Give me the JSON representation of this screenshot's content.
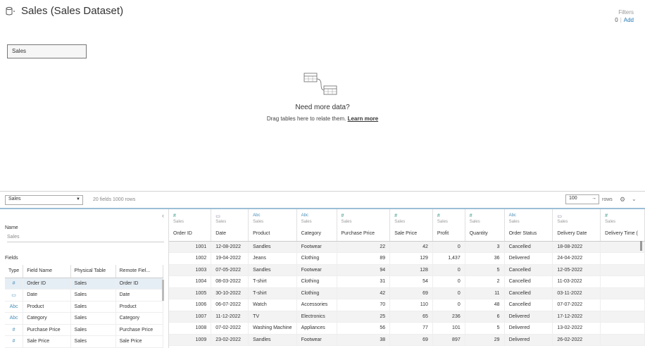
{
  "datasource": {
    "title": "Sales (Sales Dataset)",
    "icon": "datasource-icon"
  },
  "filters": {
    "label": "Filters",
    "count": "0",
    "sep": "|",
    "add": "Add"
  },
  "canvas": {
    "table_pill": "Sales",
    "need_more_title": "Need more data?",
    "need_more_sub": "Drag tables here to relate them.",
    "learn_more": "Learn more"
  },
  "toolbar": {
    "table_select": "Sales",
    "info": "20 fields 1000 rows",
    "rows_value": "100",
    "rows_arrow": "→",
    "rows_label": "rows",
    "gear_glyph": "⚙",
    "chevron_glyph": "⌄"
  },
  "meta": {
    "collapse_glyph": "‹",
    "name_label": "Name",
    "name_value": "Sales",
    "fields_label": "Fields",
    "columns": [
      "Type",
      "Field Name",
      "Physical Table",
      "Remote Fiel..."
    ],
    "rows": [
      {
        "type": "#",
        "field": "Order ID",
        "table": "Sales",
        "remote": "Order ID"
      },
      {
        "type": "▭",
        "field": "Date",
        "table": "Sales",
        "remote": "Date"
      },
      {
        "type": "Abc",
        "field": "Product",
        "table": "Sales",
        "remote": "Product"
      },
      {
        "type": "Abc",
        "field": "Category",
        "table": "Sales",
        "remote": "Category"
      },
      {
        "type": "#",
        "field": "Purchase Price",
        "table": "Sales",
        "remote": "Purchase Price"
      },
      {
        "type": "#",
        "field": "Sale Price",
        "table": "Sales",
        "remote": "Sale Price"
      }
    ]
  },
  "grid": {
    "columns": [
      {
        "type": "#",
        "kind": "num",
        "source": "Sales",
        "name": "Order ID"
      },
      {
        "type": "▭",
        "kind": "dt",
        "source": "Sales",
        "name": "Date"
      },
      {
        "type": "Abc",
        "kind": "txt",
        "source": "Sales",
        "name": "Product"
      },
      {
        "type": "Abc",
        "kind": "txt",
        "source": "Sales",
        "name": "Category"
      },
      {
        "type": "#",
        "kind": "num",
        "source": "Sales",
        "name": "Purchase Price"
      },
      {
        "type": "#",
        "kind": "num",
        "source": "Sales",
        "name": "Sale Price"
      },
      {
        "type": "#",
        "kind": "num",
        "source": "Sales",
        "name": "Profit"
      },
      {
        "type": "#",
        "kind": "num",
        "source": "Sales",
        "name": "Quantity"
      },
      {
        "type": "Abc",
        "kind": "txt",
        "source": "Sales",
        "name": "Order Status"
      },
      {
        "type": "▭",
        "kind": "dt",
        "source": "Sales",
        "name": "Delivery Date"
      },
      {
        "type": "#",
        "kind": "num",
        "source": "Sales",
        "name": "Delivery Time ("
      }
    ],
    "rows": [
      [
        "1001",
        "12-08-2022",
        "Sandles",
        "Footwear",
        "22",
        "42",
        "0",
        "3",
        "Cancelled",
        "18-08-2022",
        ""
      ],
      [
        "1002",
        "19-04-2022",
        "Jeans",
        "Clothing",
        "89",
        "129",
        "1,437",
        "36",
        "Delivered",
        "24-04-2022",
        ""
      ],
      [
        "1003",
        "07-05-2022",
        "Sandles",
        "Footwear",
        "94",
        "128",
        "0",
        "5",
        "Cancelled",
        "12-05-2022",
        ""
      ],
      [
        "1004",
        "08-03-2022",
        "T-shirt",
        "Clothing",
        "31",
        "54",
        "0",
        "2",
        "Cancelled",
        "11-03-2022",
        ""
      ],
      [
        "1005",
        "30-10-2022",
        "T-shirt",
        "Clothing",
        "42",
        "69",
        "0",
        "11",
        "Cancelled",
        "03-11-2022",
        ""
      ],
      [
        "1006",
        "06-07-2022",
        "Watch",
        "Accessories",
        "70",
        "110",
        "0",
        "48",
        "Cancelled",
        "07-07-2022",
        ""
      ],
      [
        "1007",
        "11-12-2022",
        "TV",
        "Electronics",
        "25",
        "65",
        "236",
        "6",
        "Delivered",
        "17-12-2022",
        ""
      ],
      [
        "1008",
        "07-02-2022",
        "Washing Machine",
        "Appliances",
        "56",
        "77",
        "101",
        "5",
        "Delivered",
        "13-02-2022",
        ""
      ],
      [
        "1009",
        "23-02-2022",
        "Sandles",
        "Footwear",
        "38",
        "69",
        "897",
        "29",
        "Delivered",
        "26-02-2022",
        ""
      ]
    ]
  }
}
